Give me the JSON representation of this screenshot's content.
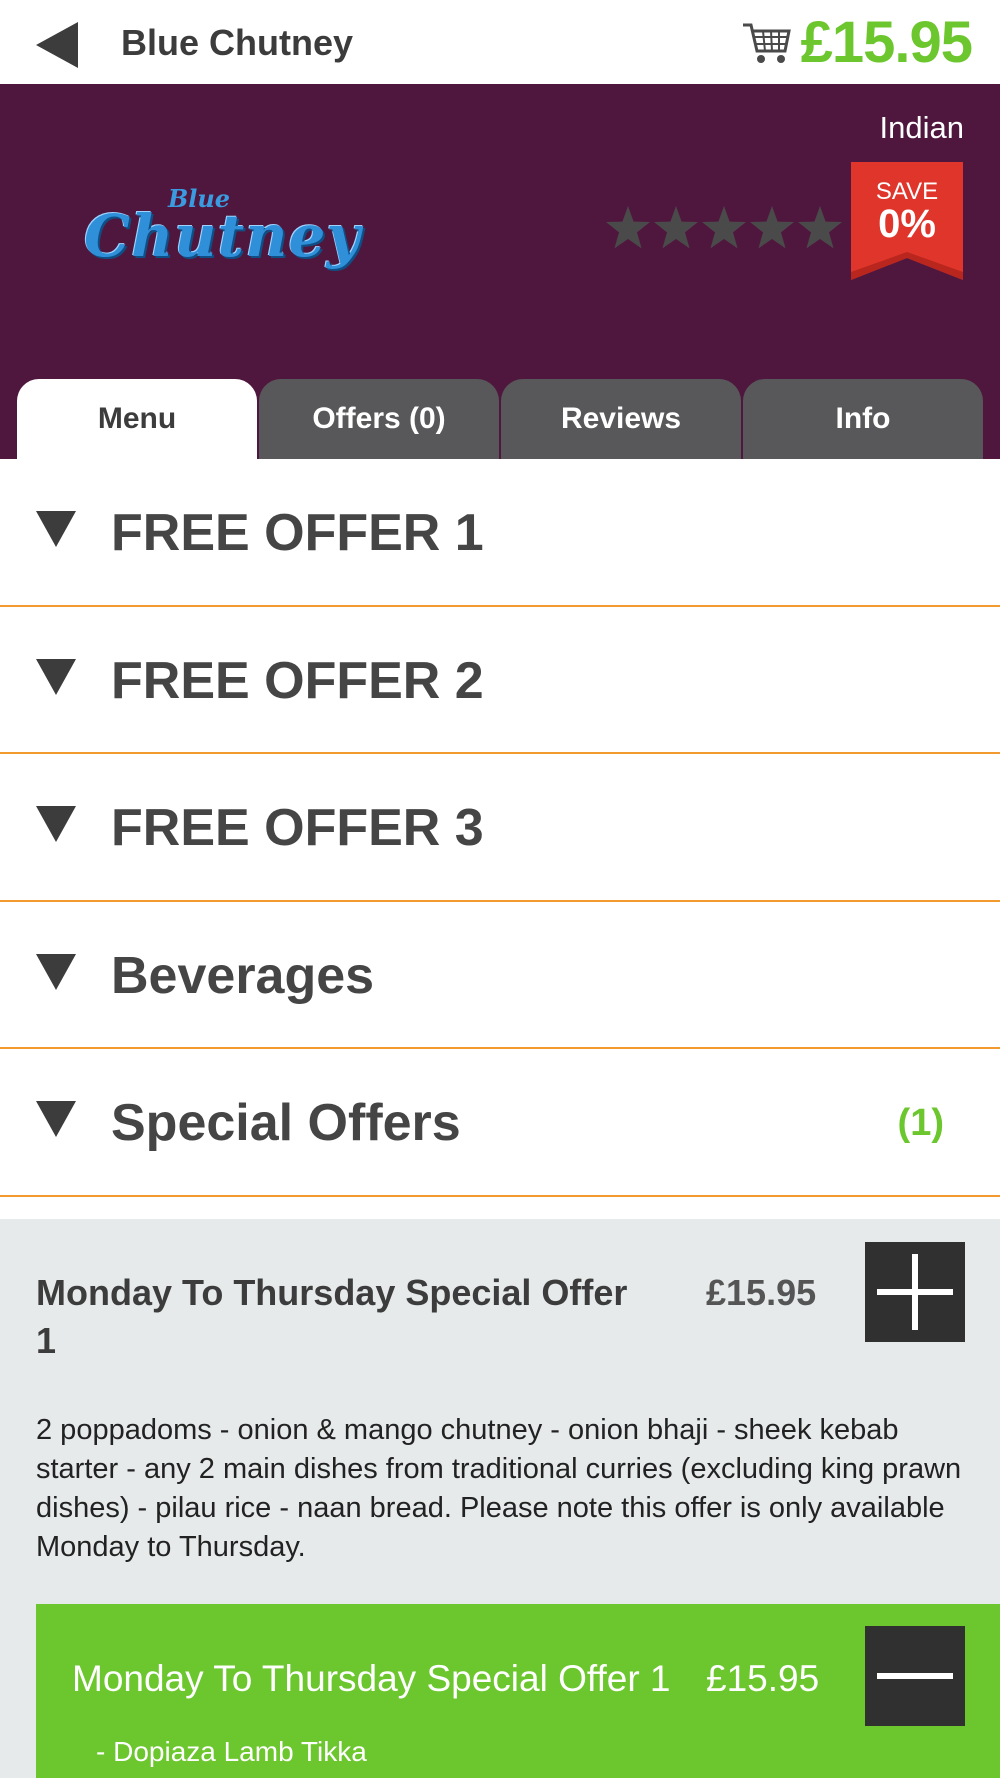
{
  "header": {
    "title": "Blue Chutney",
    "cart_total": "£15.95",
    "cart_color": "#6cc62d"
  },
  "hero": {
    "cuisine": "Indian",
    "logo_small": "Blue",
    "logo_main": "Chutney",
    "rating_stars": 5,
    "rating_filled": 0,
    "save_label": "SAVE",
    "save_value": "0%",
    "background": "#50173e"
  },
  "tabs": [
    {
      "label": "Menu",
      "active": true
    },
    {
      "label": "Offers (0)",
      "active": false
    },
    {
      "label": "Reviews",
      "active": false
    },
    {
      "label": "Info",
      "active": false
    }
  ],
  "categories": [
    {
      "label": "FREE OFFER 1",
      "count": ""
    },
    {
      "label": "FREE OFFER 2",
      "count": ""
    },
    {
      "label": "FREE OFFER 3",
      "count": ""
    },
    {
      "label": "Beverages",
      "count": ""
    },
    {
      "label": "Special Offers",
      "count": "(1)"
    }
  ],
  "menu_item": {
    "name": "Monday To Thursday Special Offer 1",
    "price": "£15.95",
    "description": "2 poppadoms - onion & mango chutney - onion bhaji - sheek kebab starter - any 2 main dishes from traditional curries (excluding king prawn dishes) - pilau rice - naan bread. Please note this offer is only available Monday to Thursday."
  },
  "basket_item": {
    "name": "Monday To Thursday Special Offer 1",
    "price": "£15.95",
    "option": "- Dopiaza Lamb Tikka"
  },
  "icons": {
    "back": "back-arrow-icon",
    "cart": "shopping-cart-icon",
    "star": "star-icon",
    "expand": "triangle-down-icon",
    "add": "plus-icon",
    "remove": "minus-icon"
  },
  "colors": {
    "accent_green": "#6cc62d",
    "divider_orange": "#f39a2e",
    "badge_red": "#e0352b",
    "tab_gray": "#58585a"
  }
}
